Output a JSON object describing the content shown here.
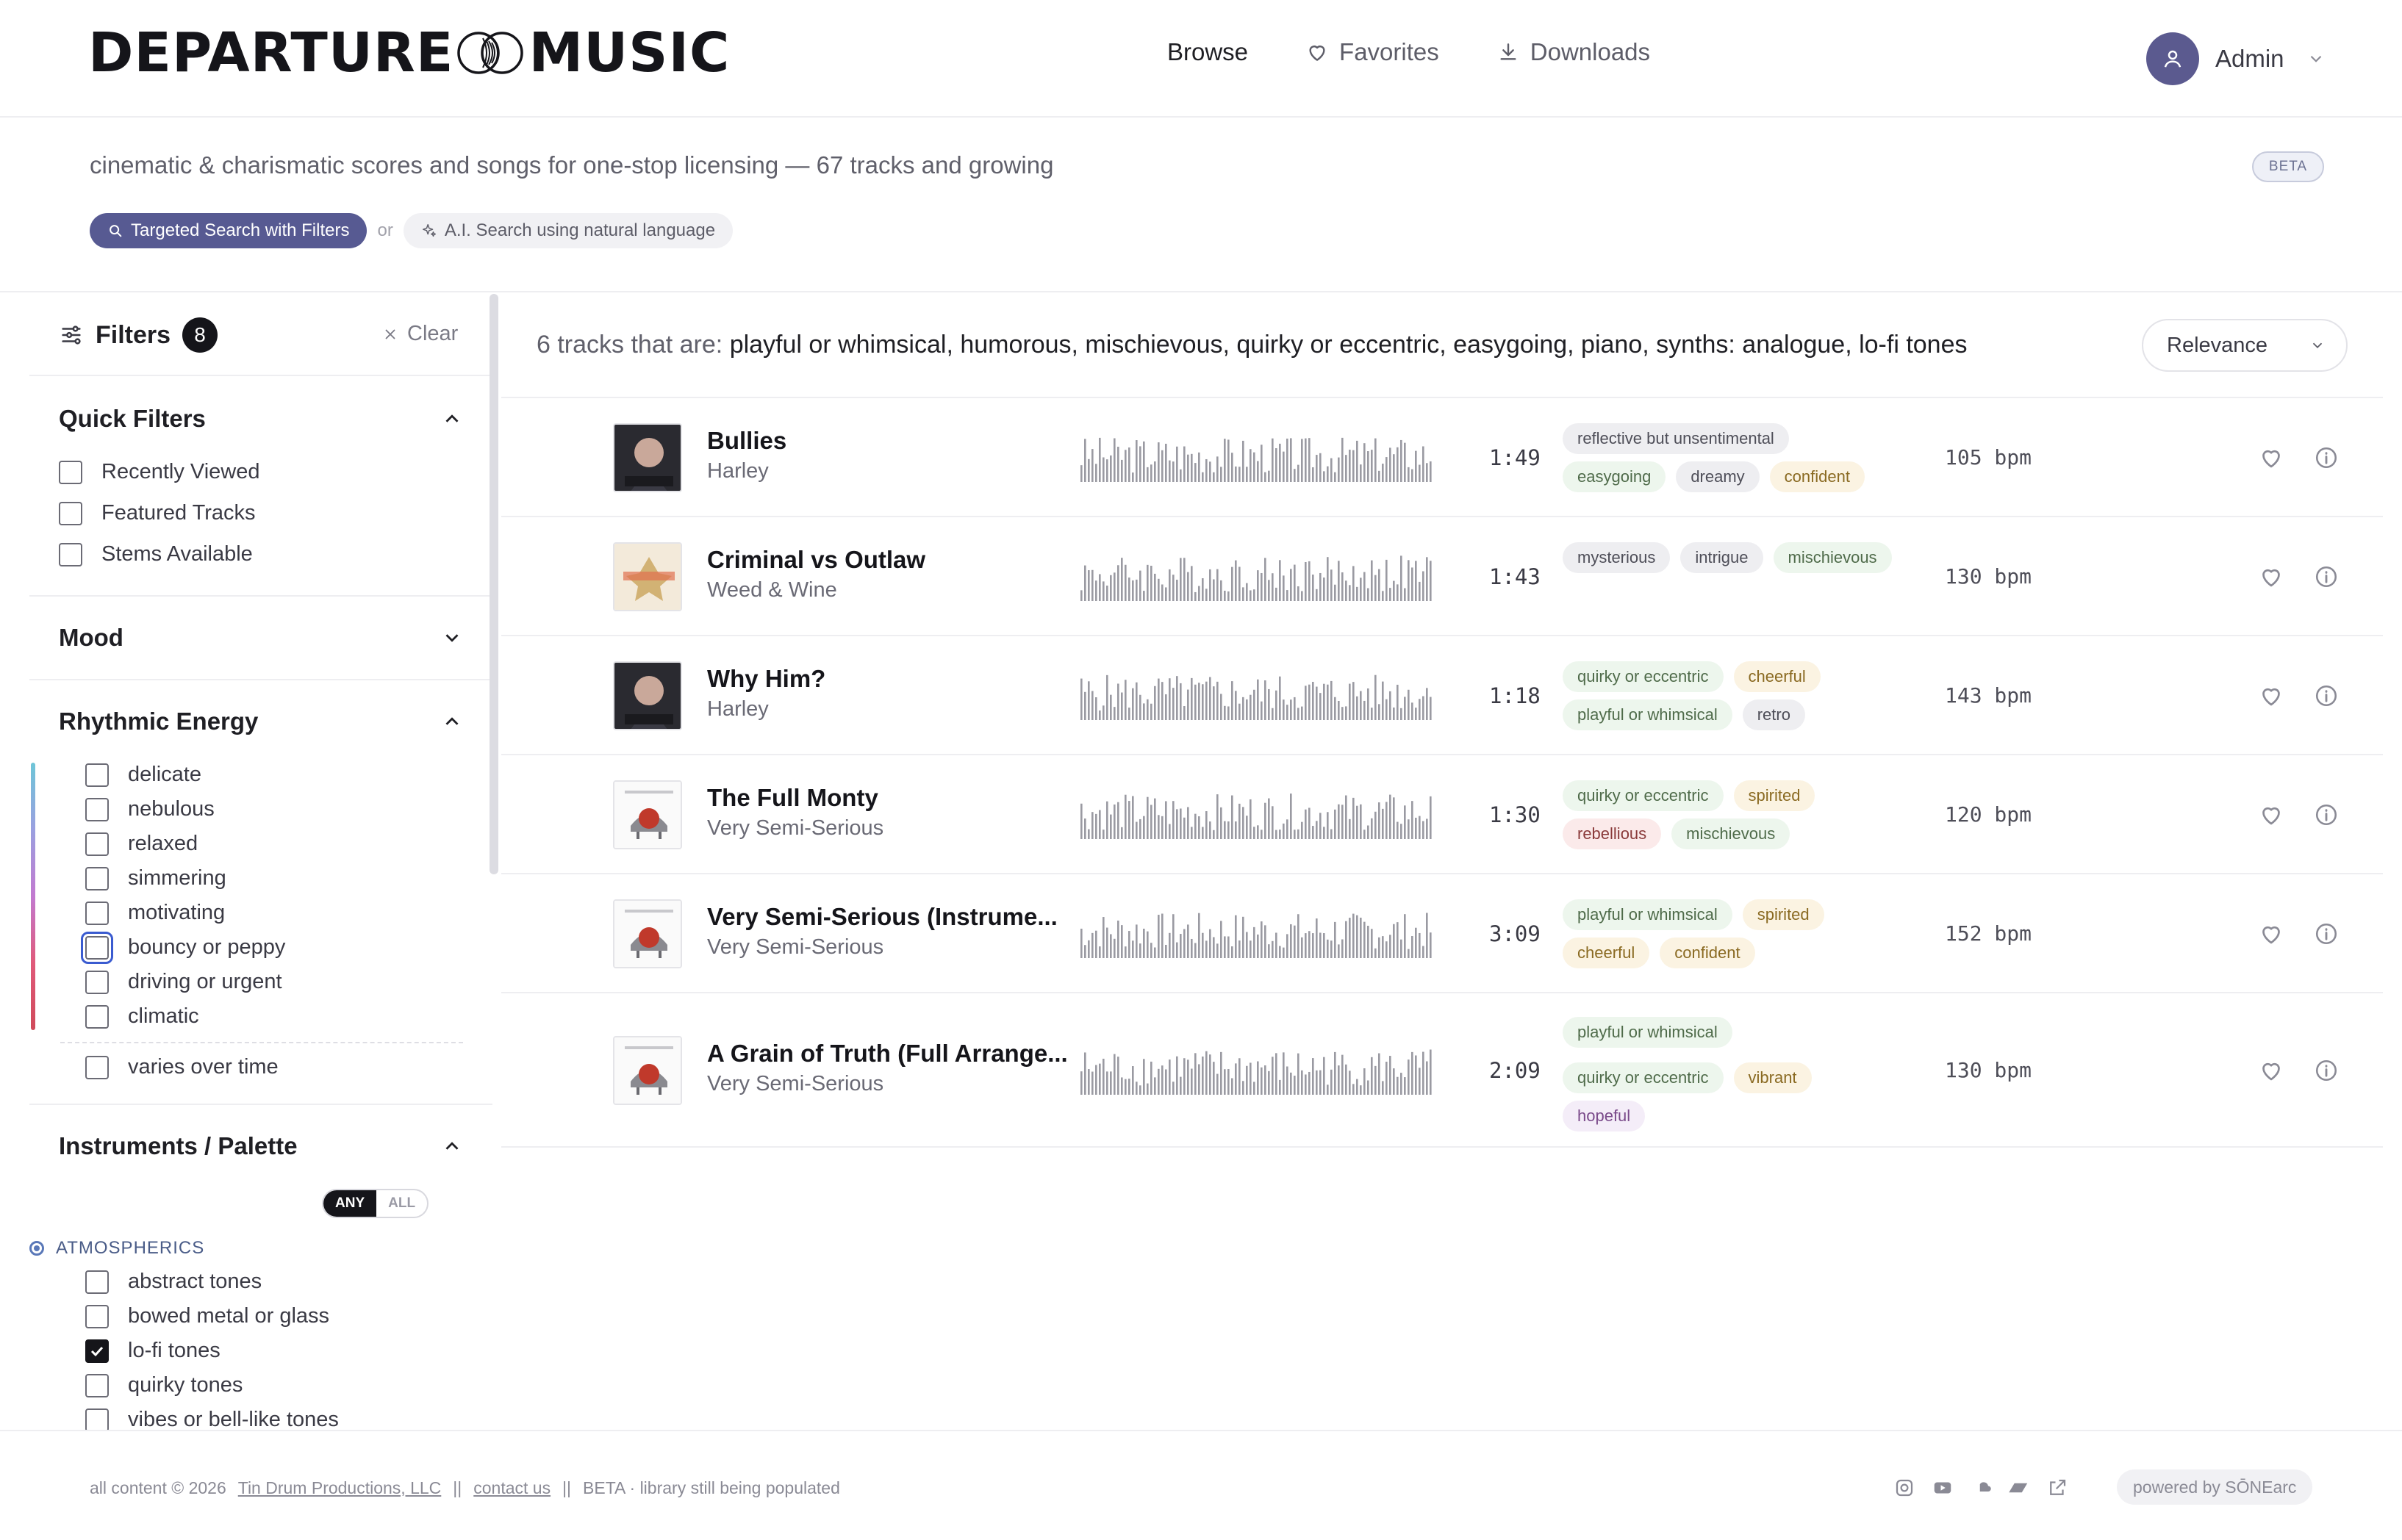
{
  "header": {
    "logo_left": "DEPARTURE",
    "logo_right": "MUSIC",
    "nav": [
      {
        "label": "Browse",
        "icon": "none",
        "active": true
      },
      {
        "label": "Favorites",
        "icon": "heart-icon",
        "active": false
      },
      {
        "label": "Downloads",
        "icon": "download-icon",
        "active": false
      }
    ],
    "user_name": "Admin"
  },
  "intro": {
    "tagline": "cinematic & charismatic scores and songs for one-stop licensing — 67 tracks and growing",
    "beta_badge": "BETA",
    "search_mode_primary": "Targeted Search with Filters",
    "search_mode_separator": "or",
    "search_mode_secondary": "A.I. Search using natural language"
  },
  "sidebar": {
    "title": "Filters",
    "count": "8",
    "clear_label": "Clear",
    "quick_filters": {
      "title": "Quick Filters",
      "items": [
        {
          "label": "Recently Viewed",
          "checked": false
        },
        {
          "label": "Featured Tracks",
          "checked": false
        },
        {
          "label": "Stems Available",
          "checked": false
        }
      ]
    },
    "mood": {
      "title": "Mood"
    },
    "rhythmic_energy": {
      "title": "Rhythmic Energy",
      "items": [
        {
          "label": "delicate",
          "checked": false
        },
        {
          "label": "nebulous",
          "checked": false
        },
        {
          "label": "relaxed",
          "checked": false
        },
        {
          "label": "simmering",
          "checked": false
        },
        {
          "label": "motivating",
          "checked": false
        },
        {
          "label": "bouncy or peppy",
          "checked": false
        },
        {
          "label": "driving or urgent",
          "checked": false
        },
        {
          "label": "climatic",
          "checked": false
        }
      ],
      "extra": "varies over time"
    },
    "instruments": {
      "title": "Instruments / Palette",
      "toggle_any": "ANY",
      "toggle_all": "ALL",
      "group": "ATMOSPHERICS",
      "items": [
        {
          "label": "abstract tones",
          "checked": false
        },
        {
          "label": "bowed metal or glass",
          "checked": false
        },
        {
          "label": "lo-fi tones",
          "checked": true
        },
        {
          "label": "quirky tones",
          "checked": false
        },
        {
          "label": "vibes or bell-like tones",
          "checked": false
        }
      ]
    }
  },
  "results": {
    "count_prefix": "6 tracks that are:",
    "criteria": "playful or whimsical, humorous, mischievous, quirky or eccentric, easygoing, piano, synths: analogue, lo-fi tones",
    "sort": "Relevance"
  },
  "tracks": [
    {
      "title": "Bullies",
      "artist": "Harley",
      "duration": "1:49",
      "bpm": "105 bpm",
      "cover": "harley",
      "tags": [
        {
          "t": "reflective but unsentimental",
          "c": "gray"
        },
        {
          "t": "easygoing",
          "c": "green"
        },
        {
          "t": "dreamy",
          "c": "gray"
        },
        {
          "t": "confident",
          "c": "yellow"
        }
      ]
    },
    {
      "title": "Criminal vs Outlaw",
      "artist": "Weed & Wine",
      "duration": "1:43",
      "bpm": "130 bpm",
      "cover": "weed",
      "tags": [
        {
          "t": "mysterious",
          "c": "gray"
        },
        {
          "t": "intrigue",
          "c": "gray"
        },
        {
          "t": "mischievous",
          "c": "green"
        }
      ]
    },
    {
      "title": "Why Him?",
      "artist": "Harley",
      "duration": "1:18",
      "bpm": "143 bpm",
      "cover": "harley",
      "tags": [
        {
          "t": "quirky or eccentric",
          "c": "green"
        },
        {
          "t": "cheerful",
          "c": "yellow"
        },
        {
          "t": "playful or whimsical",
          "c": "green"
        },
        {
          "t": "retro",
          "c": "gray"
        }
      ]
    },
    {
      "title": "The Full Monty",
      "artist": "Very Semi-Serious",
      "duration": "1:30",
      "bpm": "120 bpm",
      "cover": "vss",
      "tags": [
        {
          "t": "quirky or eccentric",
          "c": "green"
        },
        {
          "t": "spirited",
          "c": "yellow"
        },
        {
          "t": "rebellious",
          "c": "red"
        },
        {
          "t": "mischievous",
          "c": "green"
        }
      ]
    },
    {
      "title": "Very Semi-Serious (Instrume...",
      "artist": "Very Semi-Serious",
      "duration": "3:09",
      "bpm": "152 bpm",
      "cover": "vss",
      "tags": [
        {
          "t": "playful or whimsical",
          "c": "green"
        },
        {
          "t": "spirited",
          "c": "yellow"
        },
        {
          "t": "cheerful",
          "c": "yellow"
        },
        {
          "t": "confident",
          "c": "yellow"
        }
      ]
    },
    {
      "title": "A Grain of Truth (Full Arrange...",
      "artist": "Very Semi-Serious",
      "duration": "2:09",
      "bpm": "130 bpm",
      "cover": "vss",
      "tags": [
        {
          "t": "playful or whimsical",
          "c": "green"
        },
        {
          "t": "quirky or eccentric",
          "c": "green"
        },
        {
          "t": "vibrant",
          "c": "yellow"
        },
        {
          "t": "hopeful",
          "c": "purple"
        }
      ]
    }
  ],
  "footer": {
    "copyright_prefix": "all content © 2026",
    "company_link": "Tin Drum Productions, LLC",
    "sep1": "||",
    "contact_link": "contact us",
    "sep2": "||",
    "beta_note": "BETA · library still being populated",
    "social_icons": [
      "instagram-icon",
      "youtube-icon",
      "soundcloud-icon",
      "bandcamp-icon",
      "external-link-icon"
    ],
    "powered_by": "powered by SŌNEarc"
  },
  "colors": {
    "accent": "#575a92",
    "avatar": "#5b5a8f",
    "text": "#1f1f24"
  }
}
